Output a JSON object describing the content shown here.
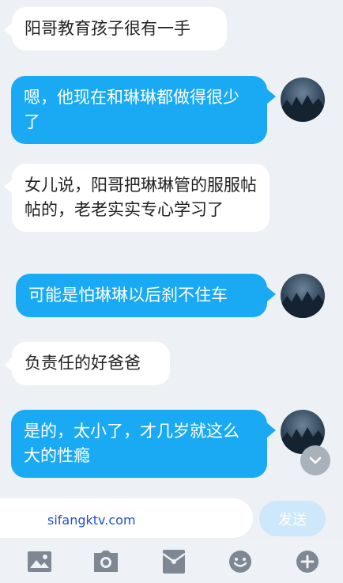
{
  "messages": [
    {
      "side": "in",
      "text": "阳哥教育孩子很有一手"
    },
    {
      "side": "out",
      "text": "嗯，他现在和琳琳都做得很少了"
    },
    {
      "side": "in",
      "text": "女儿说，阳哥把琳琳管的服服帖帖的，老老实实专心学习了"
    },
    {
      "side": "out",
      "text": "可能是怕琳琳以后刹不住车"
    },
    {
      "side": "in",
      "text": "负责任的好爸爸"
    },
    {
      "side": "out",
      "text": "是的，太小了，才几岁就这么大的性瘾"
    }
  ],
  "input": {
    "text": "sifangktv.com"
  },
  "send_label": "发送",
  "toolbar": [
    "image-icon",
    "camera-icon",
    "red-packet-icon",
    "emoji-icon",
    "plus-icon"
  ],
  "colors": {
    "bubble_out": "#1aaaf3",
    "bubble_in": "#ffffff",
    "background": "#edf0f5",
    "send_disabled": "#cde8fa",
    "link_text": "#1f4fd6"
  }
}
